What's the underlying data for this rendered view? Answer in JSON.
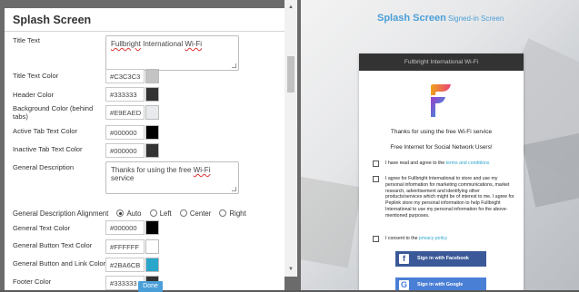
{
  "settings": {
    "title": "Splash Screen",
    "fields": {
      "title_text": {
        "label": "Title Text",
        "value_pre": "Fullbright",
        "value_mid": " International ",
        "value_post": "Wi-Fi"
      },
      "title_text_color": {
        "label": "Title Text Color",
        "value": "#C3C3C3",
        "swatch": "#C3C3C3"
      },
      "header_color": {
        "label": "Header Color",
        "value": "#333333",
        "swatch": "#333333"
      },
      "background_color": {
        "label": "Background Color (behind tabs)",
        "value": "#E9EAED",
        "swatch": "#E9EAED"
      },
      "active_tab_text_color": {
        "label": "Active Tab Text Color",
        "value": "#000000",
        "swatch": "#000000"
      },
      "inactive_tab_text_color": {
        "label": "Inactive Tab Text Color",
        "value": "#000000",
        "swatch": "#333333"
      },
      "general_description": {
        "label": "General Description",
        "value_pre": "Thanks for using the free ",
        "value_squiggle": "Wi-Fi",
        "value_post": " service"
      },
      "alignment": {
        "label": "General Description Alignment",
        "options": [
          "Auto",
          "Left",
          "Center",
          "Right"
        ],
        "selected": "Auto"
      },
      "general_text_color": {
        "label": "General Text Color",
        "value": "#000000",
        "swatch": "#000000"
      },
      "general_button_text_color": {
        "label": "General Button Text Color",
        "value": "#FFFFFF",
        "swatch": "#FFFFFF"
      },
      "general_button_link_color": {
        "label": "General Button and Link Color",
        "value": "#2BA6CB",
        "swatch": "#2BA6CB"
      },
      "footer_color": {
        "label": "Footer Color",
        "value": "#333333",
        "swatch": "#333333"
      }
    },
    "done_label": "Done"
  },
  "preview": {
    "title": "Splash Screen",
    "subtitle": "Signed-in Screen",
    "card_header": "Fullbright International Wi-Fi",
    "description_1": "Thanks for using the free Wi-Fi service",
    "description_2": "Free Internet for Social Network Users!",
    "terms_prefix": "I have read and agree to the ",
    "terms_link": "terms and conditions",
    "marketing_text": "I agree for Fullbright International to store and use my personal information for marketing communications, market research, advertisement and identifying other products/services which might be of interest to me. I agree for Peplink store my personal information to help Fullbright International to use my personal information for the above-mentioned purposes.",
    "consent_prefix": "I consent to the ",
    "consent_link": "privacy policy",
    "facebook_label": "Sign in with Facebook",
    "google_label": "Sign in with Google",
    "facebook_color": "#3b5998",
    "google_color": "#4a7fd6",
    "link_color": "#2ba6cb"
  }
}
